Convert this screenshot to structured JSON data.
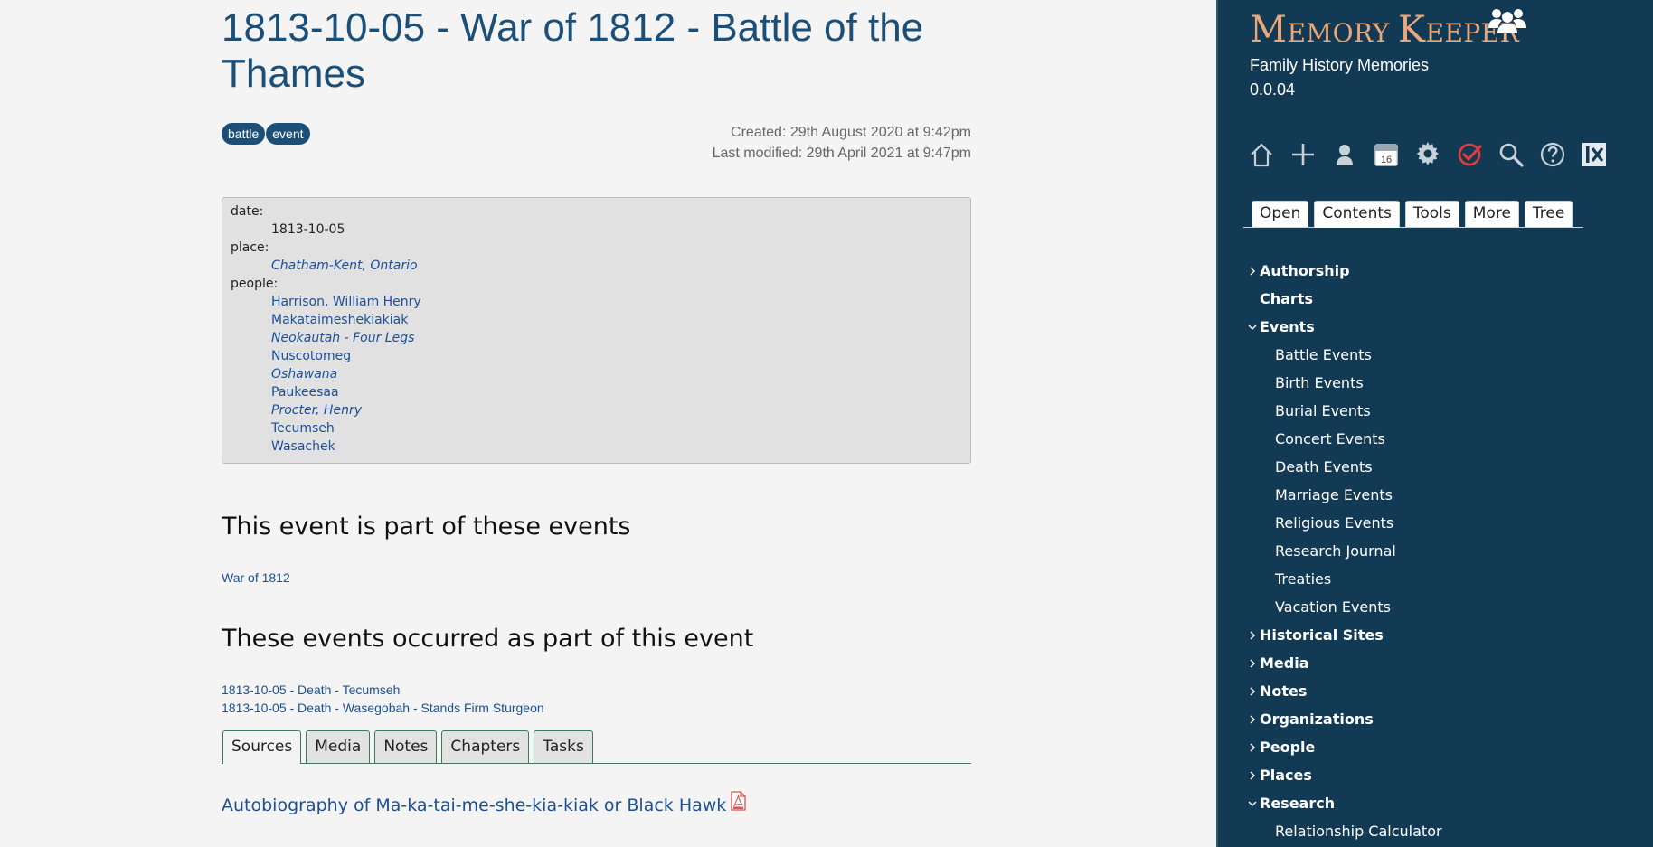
{
  "title": "1813-10-05 - War of 1812 - Battle of the Thames",
  "tags": [
    "battle",
    "event"
  ],
  "meta": {
    "created": "Created: 29th August 2020 at 9:42pm",
    "modified": "Last modified: 29th April 2021 at 9:47pm"
  },
  "info": {
    "date_label": "date:",
    "date_value": "1813-10-05",
    "place_label": "place:",
    "place_value": "Chatham-Kent, Ontario",
    "people_label": "people:",
    "people": [
      {
        "name": "Harrison, William Henry",
        "italic": false
      },
      {
        "name": "Makataimeshekiakiak",
        "italic": false
      },
      {
        "name": "Neokautah - Four Legs",
        "italic": true
      },
      {
        "name": "Nuscotomeg",
        "italic": false
      },
      {
        "name": "Oshawana",
        "italic": true
      },
      {
        "name": "Paukeesaa",
        "italic": false
      },
      {
        "name": "Procter, Henry",
        "italic": true
      },
      {
        "name": "Tecumseh",
        "italic": false
      },
      {
        "name": "Wasachek",
        "italic": false
      }
    ]
  },
  "parent_section": {
    "heading": "This event is part of these events",
    "links": [
      "War of 1812"
    ]
  },
  "child_section": {
    "heading": "These events occurred as part of this event",
    "links": [
      "1813-10-05 - Death - Tecumseh",
      "1813-10-05 - Death - Wasegobah - Stands Firm Sturgeon"
    ]
  },
  "main_tabs": [
    "Sources",
    "Media",
    "Notes",
    "Chapters",
    "Tasks"
  ],
  "main_tab_active": "Sources",
  "source_link": "Autobiography of Ma-ka-tai-me-she-kia-kiak or Black Hawk",
  "sidebar": {
    "brand_first_m": "M",
    "brand_first_rest": "EMORY",
    "brand_second_k": "K",
    "brand_second_rest": "EEPER",
    "subtitle": "Family History Memories",
    "version": "0.0.04",
    "toolbar_icons": [
      "home-icon",
      "plus-icon",
      "person-icon",
      "calendar-icon",
      "gear-icon",
      "tasks-check-icon",
      "search-icon",
      "help-icon",
      "close-panel-icon"
    ],
    "calendar_day": "16",
    "tabs": [
      "Open",
      "Contents",
      "Tools",
      "More",
      "Tree"
    ],
    "tab_active": "Contents",
    "tree": [
      {
        "label": "Authorship",
        "level": 0,
        "chevron": "right"
      },
      {
        "label": "Charts",
        "level": 0,
        "chevron": "none"
      },
      {
        "label": "Events",
        "level": 0,
        "chevron": "down"
      },
      {
        "label": "Battle Events",
        "level": 1
      },
      {
        "label": "Birth Events",
        "level": 1
      },
      {
        "label": "Burial Events",
        "level": 1
      },
      {
        "label": "Concert Events",
        "level": 1
      },
      {
        "label": "Death Events",
        "level": 1
      },
      {
        "label": "Marriage Events",
        "level": 1
      },
      {
        "label": "Religious Events",
        "level": 1
      },
      {
        "label": "Research Journal",
        "level": 1
      },
      {
        "label": "Treaties",
        "level": 1
      },
      {
        "label": "Vacation Events",
        "level": 1
      },
      {
        "label": "Historical Sites",
        "level": 0,
        "chevron": "right"
      },
      {
        "label": "Media",
        "level": 0,
        "chevron": "right"
      },
      {
        "label": "Notes",
        "level": 0,
        "chevron": "right"
      },
      {
        "label": "Organizations",
        "level": 0,
        "chevron": "right"
      },
      {
        "label": "People",
        "level": 0,
        "chevron": "right"
      },
      {
        "label": "Places",
        "level": 0,
        "chevron": "right"
      },
      {
        "label": "Research",
        "level": 0,
        "chevron": "down"
      },
      {
        "label": "Relationship Calculator",
        "level": 1
      }
    ]
  },
  "colors": {
    "title_blue": "#1b4f78",
    "link_blue": "#1b4f98",
    "sidebar_bg": "#133a54",
    "brand_orange": "#e8a87c",
    "task_red": "#e63b3b",
    "tab_border_green": "#3d7a5c"
  }
}
